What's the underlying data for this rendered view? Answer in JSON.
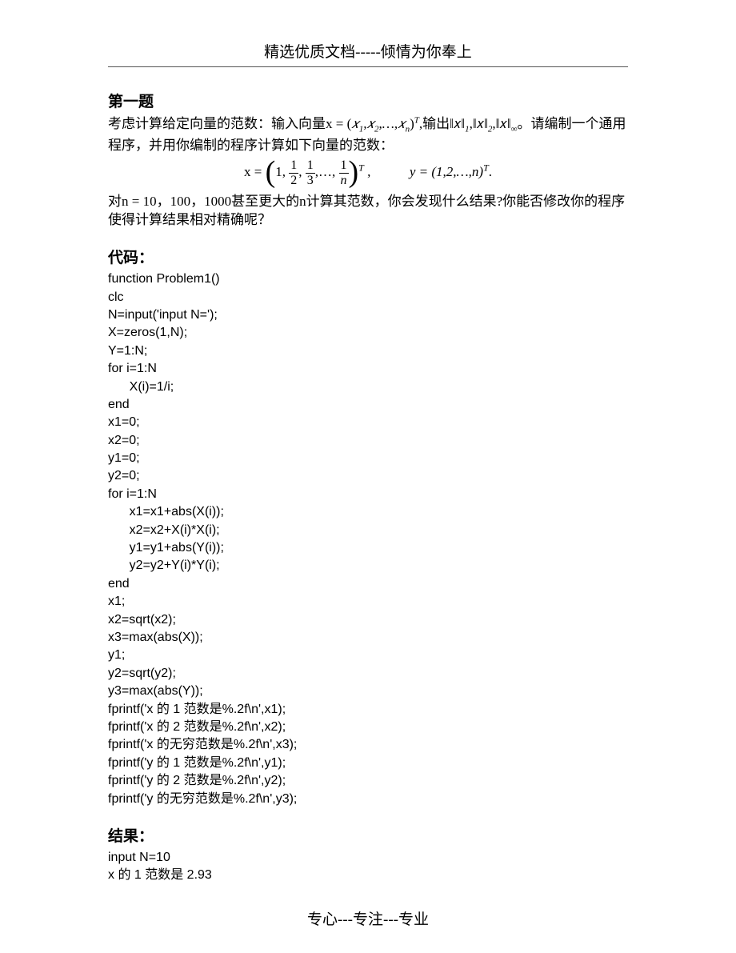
{
  "header": "精选优质文档-----倾情为你奉上",
  "footer": "专心---专注---专业",
  "section1": {
    "title": "第一题",
    "p1_a": "考虑计算给定向量的范数：输入向量x = (",
    "p1_b": ")",
    "p1_c": ",输出‖𝑥‖",
    "p1_d": ",‖𝑥‖",
    "p1_e": ",‖𝑥‖",
    "p1_f": "。请编制一个通用程序，并用你编制的程序计算如下向量的范数：",
    "p2": "对n = 10，100，1000甚至更大的n计算其范数，你会发现什么结果?你能否修改你的程序使得计算结果相对精确呢？"
  },
  "formula": {
    "x_eq": "x = ",
    "one": "1,",
    "comma": ", ",
    "ldots": "…",
    "T": "T",
    "y_eq": "y = (1,2,…,n)",
    "period": "."
  },
  "code_title": "代码：",
  "code_lines": [
    "function Problem1()",
    "clc",
    "N=input('input N=');",
    "X=zeros(1,N);",
    "Y=1:N;",
    "for i=1:N",
    "      X(i)=1/i;",
    "end",
    "x1=0;",
    "x2=0;",
    "y1=0;",
    "y2=0;",
    "for i=1:N",
    "      x1=x1+abs(X(i));",
    "      x2=x2+X(i)*X(i);",
    "      y1=y1+abs(Y(i));",
    "      y2=y2+Y(i)*Y(i);",
    "end",
    "x1;",
    "x2=sqrt(x2);",
    "x3=max(abs(X));",
    "y1;",
    "y2=sqrt(y2);",
    "y3=max(abs(Y));",
    "fprintf('x 的 1 范数是%.2f\\n',x1);",
    "fprintf('x 的 2 范数是%.2f\\n',x2);",
    "fprintf('x 的无穷范数是%.2f\\n',x3);",
    "fprintf('y 的 1 范数是%.2f\\n',y1);",
    "fprintf('y 的 2 范数是%.2f\\n',y2);",
    "fprintf('y 的无穷范数是%.2f\\n',y3);"
  ],
  "result_title": "结果：",
  "result_lines": [
    "input N=10",
    "x 的 1 范数是 2.93"
  ]
}
